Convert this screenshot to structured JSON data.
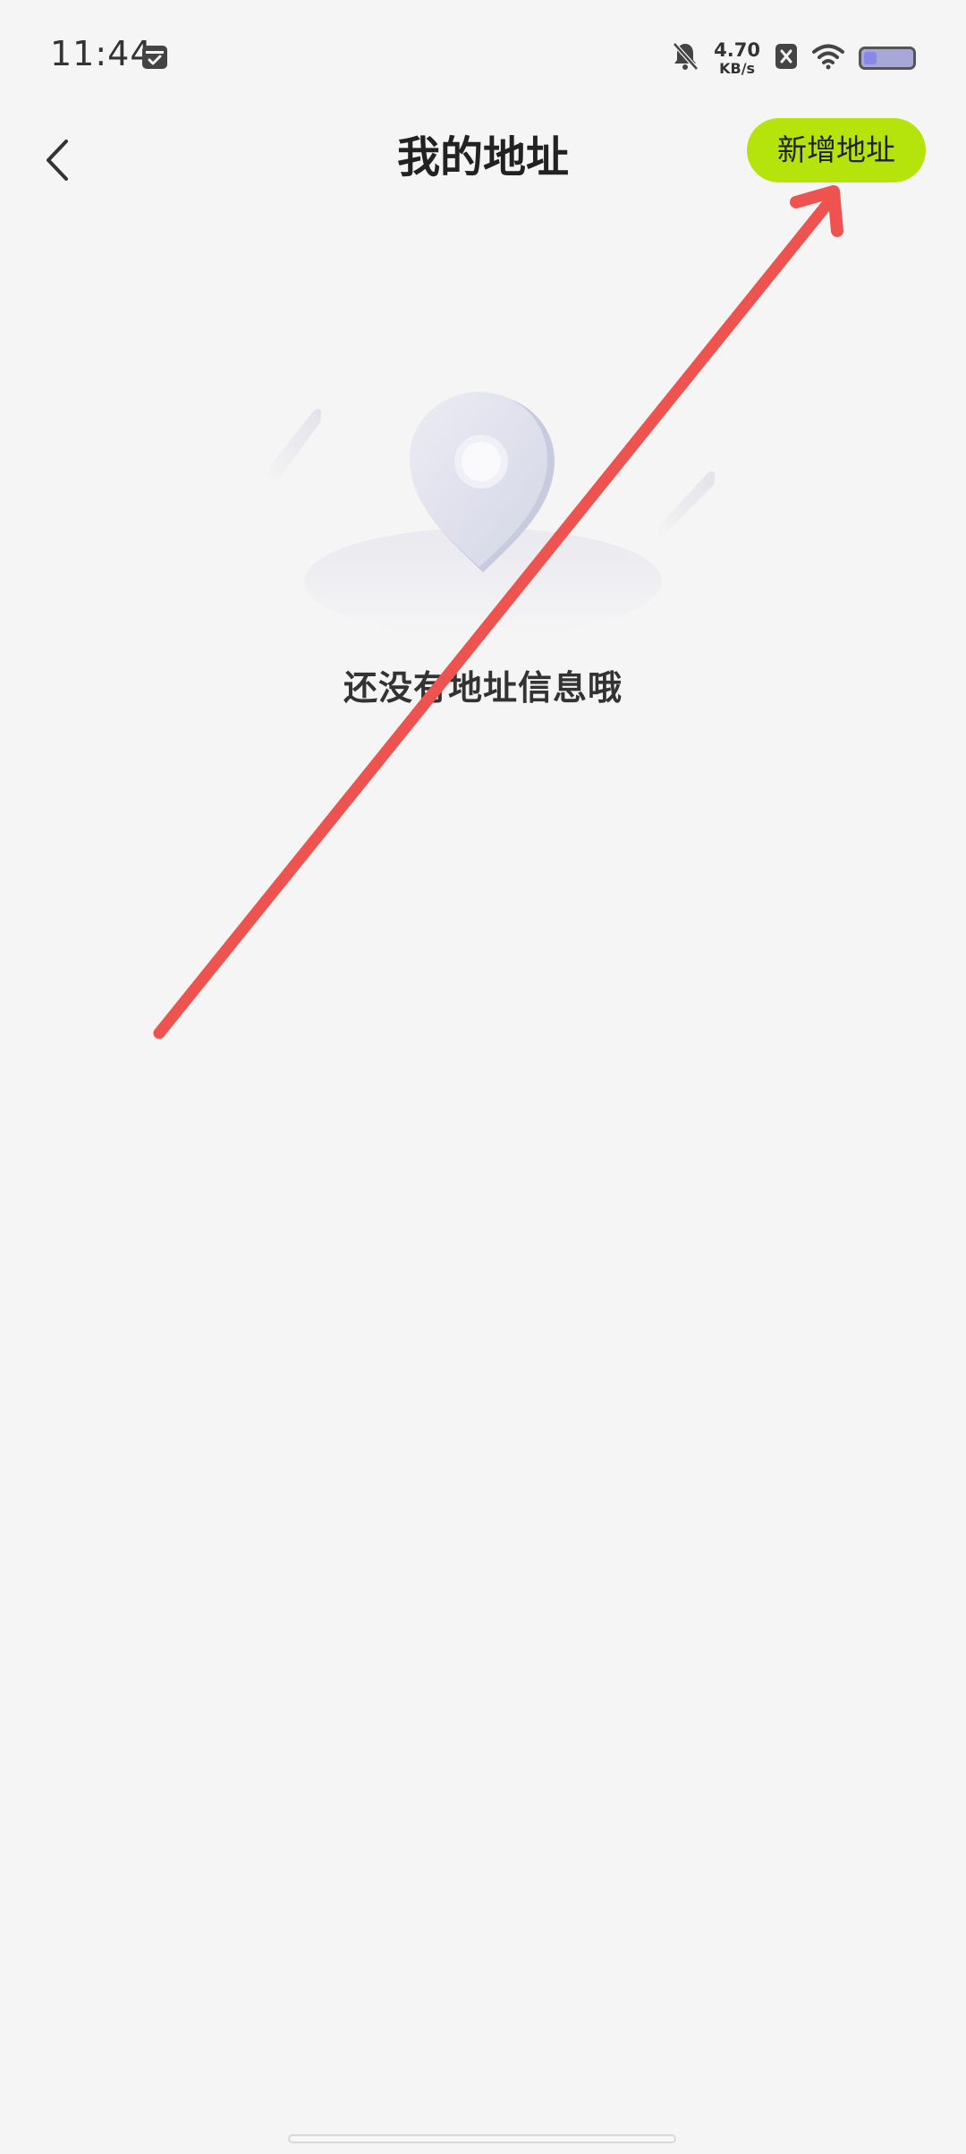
{
  "status_bar": {
    "time": "11:44",
    "net_speed_value": "4.70",
    "net_speed_unit": "KB/s",
    "icons": [
      "calendar-check-icon",
      "bell-muted-icon",
      "close-box-icon",
      "wifi-icon",
      "battery-icon"
    ]
  },
  "header": {
    "title": "我的地址",
    "add_button_label": "新增地址",
    "back_icon": "chevron-left-icon"
  },
  "empty_state": {
    "message": "还没有地址信息哦",
    "icon": "location-pin-icon"
  },
  "colors": {
    "background": "#f5f5f5",
    "accent": "#b4e40c",
    "annotation_arrow": "#ef5350"
  }
}
